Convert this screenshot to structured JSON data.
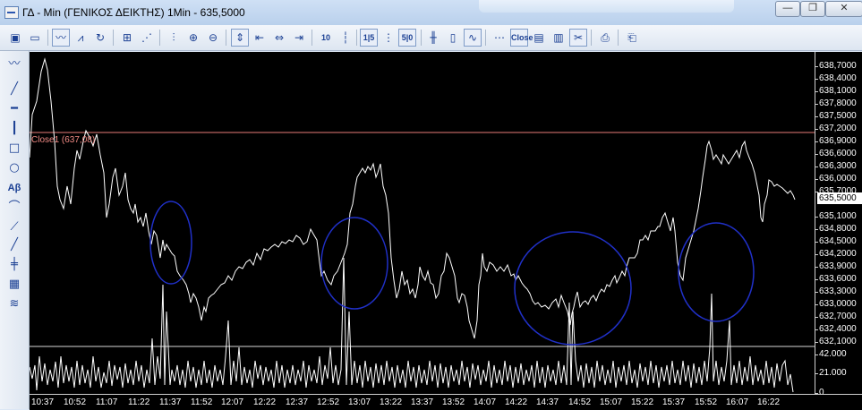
{
  "window": {
    "title": "ΓΔ - Min (ΓΕΝΙΚΟΣ ΔΕΙΚΤΗΣ) 1Min - 635,5000",
    "minimize_glyph": "—",
    "restore_glyph": "❐",
    "close_glyph": "✕"
  },
  "toolbar": {
    "close_button_label": "Close"
  },
  "left_toolbar": {
    "text_tool_label": "Aβ"
  },
  "chart": {
    "reference_line_label": "Close1 (637,08)",
    "current_price": "635,5000",
    "y_ticks": [
      "638,7000",
      "638,4000",
      "638,1000",
      "637,8000",
      "637,5000",
      "637,2000",
      "636,9000",
      "636,6000",
      "636,3000",
      "636,0000",
      "635,7000",
      "635,1000",
      "634,8000",
      "634,5000",
      "634,2000",
      "633,9000",
      "633,6000",
      "633,3000",
      "633,0000",
      "632,7000",
      "632,4000",
      "632,1000"
    ],
    "volume_ticks": [
      "42.000",
      "21.000",
      "0"
    ],
    "x_ticks": [
      "10:37",
      "10:52",
      "11:07",
      "11:22",
      "11:37",
      "11:52",
      "12:07",
      "12:22",
      "12:37",
      "12:52",
      "13:07",
      "13:22",
      "13:37",
      "13:52",
      "14:07",
      "14:22",
      "14:37",
      "14:52",
      "15:07",
      "15:22",
      "15:37",
      "15:52",
      "16:07",
      "16:22"
    ],
    "colors": {
      "background": "#000000",
      "price_line": "#ffffff",
      "reference_line": "#e87d78",
      "annotation_circle": "#2030c8"
    }
  }
}
